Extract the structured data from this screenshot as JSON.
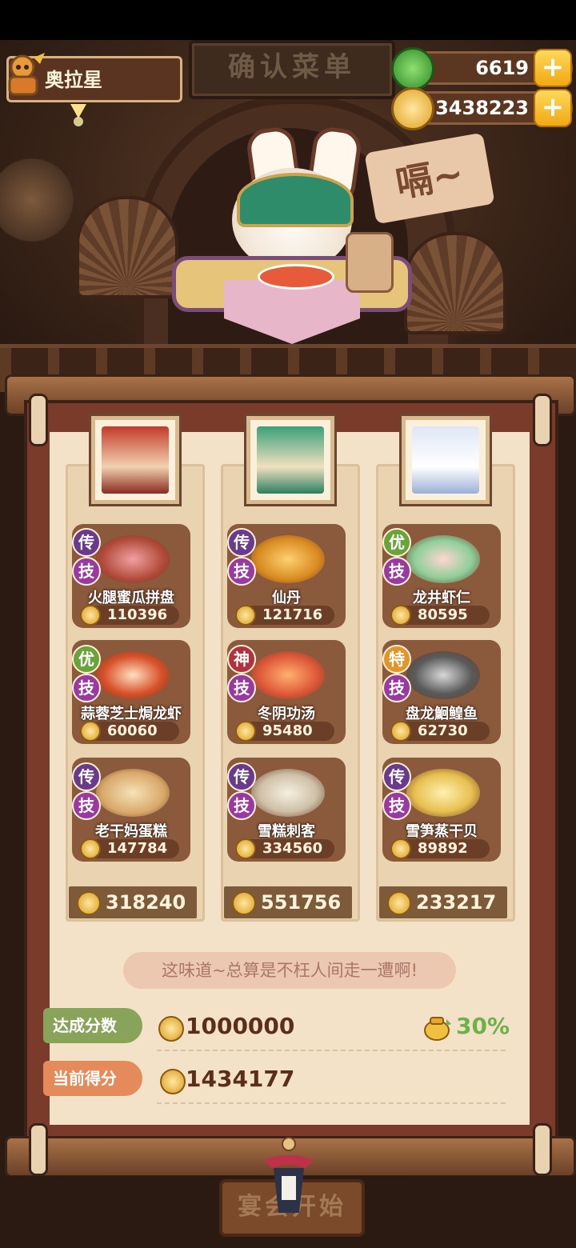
{
  "header": {
    "sign_title": "确认菜单",
    "player_name": "奥拉星",
    "jade": "6619",
    "coins": "3438223",
    "speech": "嗝~"
  },
  "columns": [
    {
      "dishes": [
        {
          "tier": "传",
          "skill": "技",
          "name": "火腿蜜瓜拼盘",
          "price": "110396"
        },
        {
          "tier": "优",
          "skill": "技",
          "name": "蒜蓉芝士焗龙虾",
          "price": "60060"
        },
        {
          "tier": "传",
          "skill": "技",
          "name": "老干妈蛋糕",
          "price": "147784"
        }
      ],
      "total": "318240"
    },
    {
      "dishes": [
        {
          "tier": "传",
          "skill": "技",
          "name": "仙丹",
          "price": "121716"
        },
        {
          "tier": "神",
          "skill": "技",
          "name": "冬阴功汤",
          "price": "95480"
        },
        {
          "tier": "传",
          "skill": "技",
          "name": "雪糕刺客",
          "price": "334560"
        }
      ],
      "total": "551756"
    },
    {
      "dishes": [
        {
          "tier": "优",
          "skill": "技",
          "name": "龙井虾仁",
          "price": "80595"
        },
        {
          "tier": "特",
          "skill": "技",
          "name": "盘龙鮰鳇鱼",
          "price": "62730"
        },
        {
          "tier": "传",
          "skill": "技",
          "name": "雪笋蒸干贝",
          "price": "89892"
        }
      ],
      "total": "233217"
    }
  ],
  "quote": "这味道~总算是不枉人间走一遭啊!",
  "target": {
    "label": "达成分数",
    "value": "1000000",
    "bonus": "30%"
  },
  "current": {
    "label": "当前得分",
    "value": "1434177"
  },
  "start_button": "宴会开始",
  "colors": {
    "legend": "#6a3a8c",
    "excellent": "#6aa33a",
    "god": "#b0323c",
    "special": "#e0962a",
    "skill": "#9a3aa0"
  }
}
